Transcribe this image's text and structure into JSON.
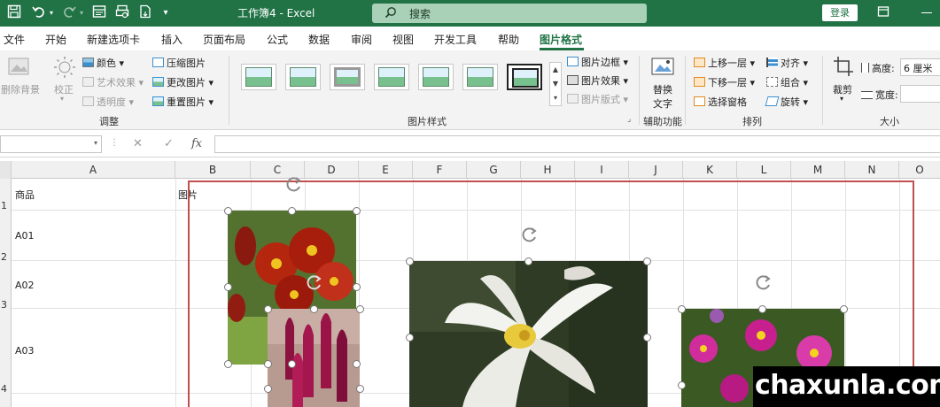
{
  "titlebar": {
    "title": "工作簿4 - Excel",
    "search_placeholder": "搜索",
    "login": "登录"
  },
  "tabs": [
    "文件",
    "开始",
    "新建选项卡",
    "插入",
    "页面布局",
    "公式",
    "数据",
    "审阅",
    "视图",
    "开发工具",
    "帮助",
    "图片格式"
  ],
  "active_tab": "图片格式",
  "ribbon": {
    "adjust": {
      "remove_bg": "删除背景",
      "correct": "校正",
      "color": "颜色",
      "artistic": "艺术效果",
      "transparency": "透明度",
      "compress": "压缩图片",
      "change": "更改图片",
      "reset": "重置图片",
      "group_label": "调整"
    },
    "styles": {
      "border": "图片边框",
      "effects": "图片效果",
      "layout": "图片版式",
      "group_label": "图片样式"
    },
    "accessibility": {
      "alt_text_1": "替换",
      "alt_text_2": "文字",
      "group_label": "辅助功能"
    },
    "arrange": {
      "bring_forward": "上移一层",
      "send_backward": "下移一层",
      "selection_pane": "选择窗格",
      "align": "对齐",
      "group": "组合",
      "rotate": "旋转",
      "group_label": "排列"
    },
    "size": {
      "crop": "裁剪",
      "height_label": "高度:",
      "height_value": "6 厘米",
      "width_label": "宽度:",
      "width_value": "",
      "group_label": "大小"
    }
  },
  "formula_bar": {
    "name_box": "",
    "cancel": "✕",
    "confirm": "✓",
    "fx": "fx",
    "content": ""
  },
  "columns": [
    "A",
    "B",
    "C",
    "D",
    "E",
    "F",
    "G",
    "H",
    "I",
    "J",
    "K",
    "L",
    "M",
    "N",
    "O"
  ],
  "rows": [
    "1",
    "2",
    "3",
    "4"
  ],
  "cells": {
    "a1": "商品",
    "b1": "图片",
    "a2": "A01",
    "a3": "A02",
    "a4": "A03"
  },
  "watermark": "chaxunla.com",
  "colors": {
    "excel_green": "#217346",
    "selection_red": "#c0504d"
  }
}
